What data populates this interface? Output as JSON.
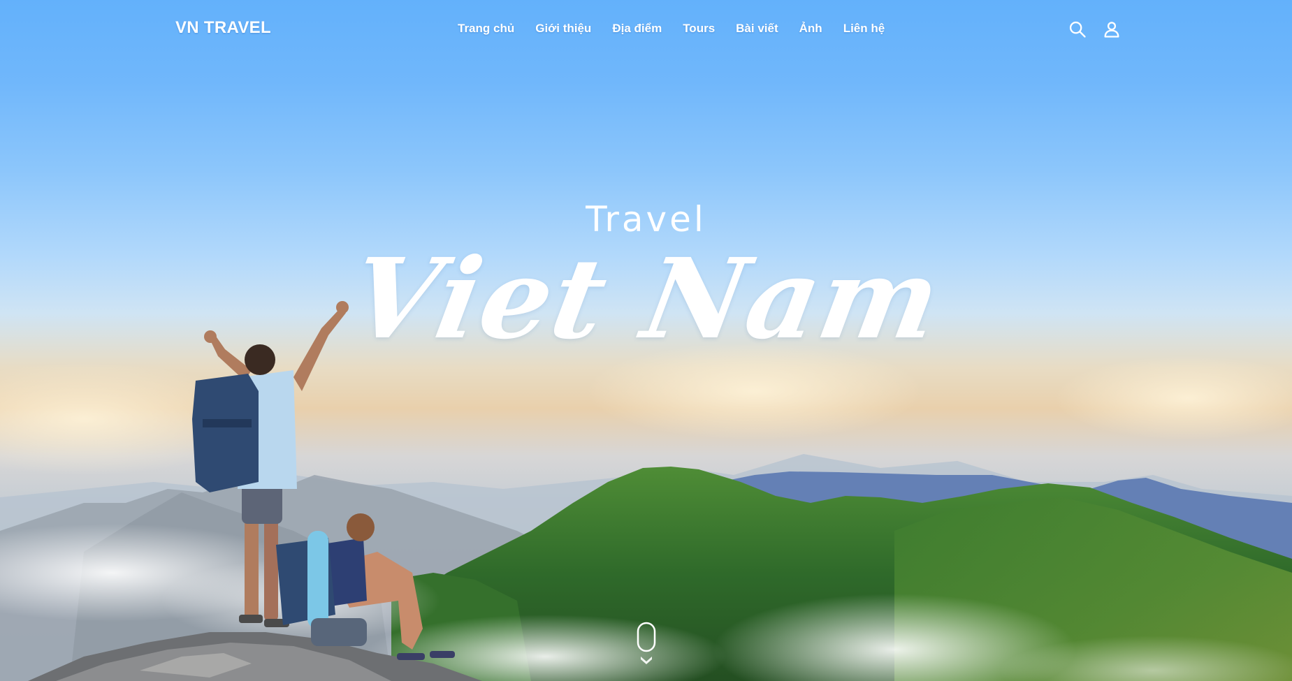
{
  "brand": {
    "logo_text": "VN TRAVEL"
  },
  "nav": {
    "items": [
      {
        "label": "Trang chủ"
      },
      {
        "label": "Giới thiệu"
      },
      {
        "label": "Địa điểm"
      },
      {
        "label": "Tours"
      },
      {
        "label": "Bài viết"
      },
      {
        "label": "Ảnh"
      },
      {
        "label": "Liên hệ"
      }
    ],
    "icons": [
      "search-icon",
      "user-icon"
    ]
  },
  "hero": {
    "title_top": "Travel",
    "title_script": "Viet Nam",
    "scroll_icon": "mouse-scroll-icon"
  },
  "colors": {
    "sky_top": "#63b1fb",
    "haze": "#e9d0ac",
    "mountain_green": "#3f7a2c",
    "text": "#ffffff"
  }
}
